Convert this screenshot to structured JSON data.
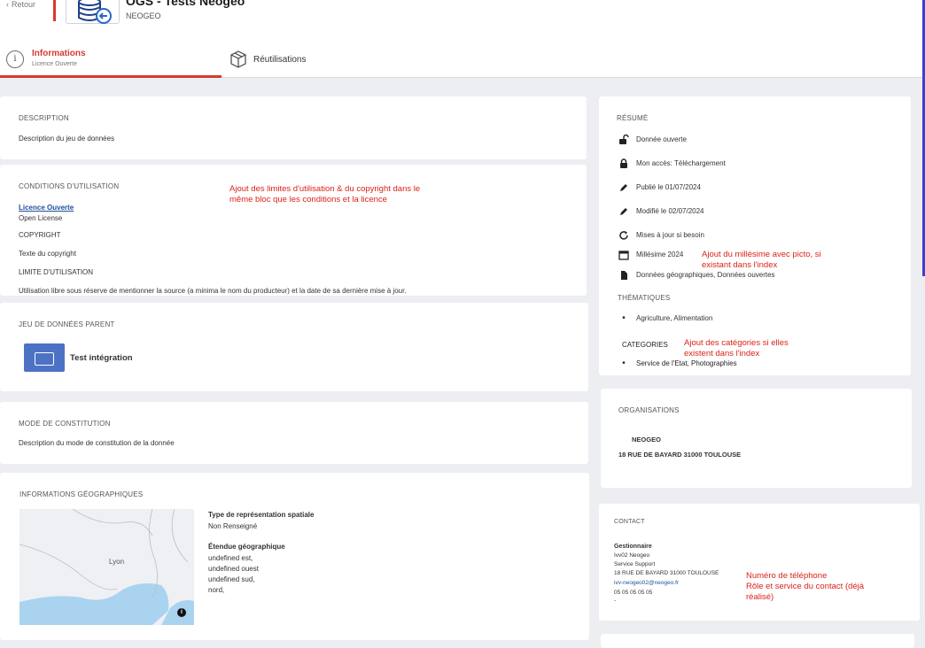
{
  "header": {
    "back_label": "Retour",
    "title": "OGS - Tests Neogeo",
    "org": "NEOGEO"
  },
  "tabs": [
    {
      "label": "Informations",
      "sub": "Licence Ouverte"
    },
    {
      "label": "Réutilisations"
    }
  ],
  "description": {
    "title": "DESCRIPTION",
    "text": "Description du jeu de données"
  },
  "conditions": {
    "title": "CONDITIONS D'UTILISATION",
    "license_link": "Licence Ouverte",
    "license_en": "Open License",
    "copyright_title": "COPYRIGHT",
    "copyright_text": "Texte du copyright",
    "limit_title": "LIMITE D'UTILISATION",
    "limit_text": "Utilisation libre sous réserve de mentionner la source (a minima le nom du producteur) et la date de sa dernière mise à jour.",
    "annotation": [
      "Ajout des limites d'utilisation & du copyright dans le",
      "même bloc que les conditions et la licence"
    ]
  },
  "parent": {
    "title": "JEU DE DONNÉES PARENT",
    "name": "Test intégration"
  },
  "mode": {
    "title": "MODE DE CONSTITUTION",
    "text": "Description du mode de constitution de la donnée"
  },
  "geo": {
    "title": "INFORMATIONS GÉOGRAPHIQUES",
    "map_city": "Lyon",
    "rep_title": "Type de représentation spatiale",
    "rep_value": "Non Renseigné",
    "extent_title": "Étendue géographique",
    "extent_lines": [
      "undefined est,",
      "undefined ouest",
      "undefined sud,",
      "nord,"
    ]
  },
  "resume": {
    "title": "RÉSUMÉ",
    "items": [
      {
        "icon": "unlock-icon",
        "label": "Donnée ouverte"
      },
      {
        "icon": "lock-icon",
        "label": "Mon accès: Téléchargement"
      },
      {
        "icon": "pen-icon",
        "label": "Publié le 01/07/2024"
      },
      {
        "icon": "pen-icon",
        "label": "Modifié le 02/07/2024"
      },
      {
        "icon": "refresh-icon",
        "label": "Mises à jour si besoin"
      },
      {
        "icon": "calendar-icon",
        "label": "Millésime 2024"
      },
      {
        "icon": "document-icon",
        "label": "Données géographiques, Données ouvertes"
      }
    ],
    "millesime_annotation": [
      "Ajout du millésime avec picto, si",
      "existant dans l'index"
    ],
    "themes_title": "THÉMATIQUES",
    "themes": "Agriculture, Alimentation",
    "categories_title": "CATEGORIES",
    "categories": "Service de l'Etat, Photographies",
    "categories_annotation": [
      "Ajout des catégories si elles",
      "existent dans l'index"
    ]
  },
  "organisations": {
    "title": "ORGANISATIONS",
    "name": "NEOGEO",
    "address": "18 RUE DE BAYARD 31000 TOULOUSE"
  },
  "contact": {
    "title": "CONTACT",
    "role": "Gestionnaire",
    "name": "Ivv02 Neogeo",
    "service": "Service Support",
    "address": "18 RUE DE BAYARD 31000 TOULOUSE",
    "email": "ivv-neogeo02@neogeo.fr",
    "phone": "05 05 05 05 05",
    "dash": "-",
    "annotation": [
      "Numéro de téléphone",
      "Rôle et service du contact (déjà",
      "réalisé)"
    ]
  }
}
